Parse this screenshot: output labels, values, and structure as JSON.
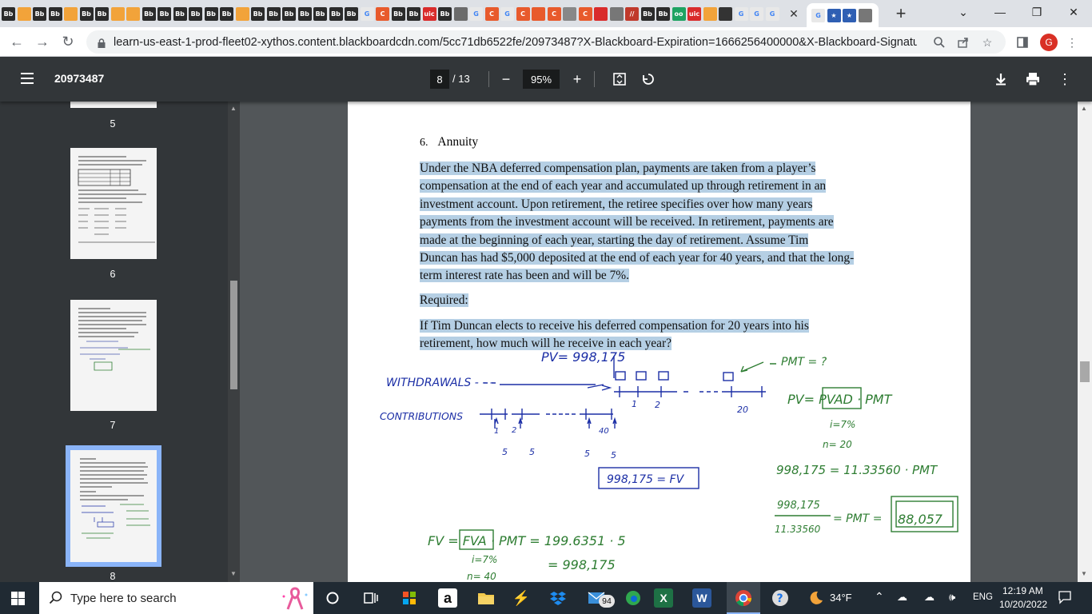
{
  "browser": {
    "tab_favicons": [
      {
        "label": "Bb",
        "color": "#2b2b2b"
      },
      {
        "label": "",
        "color": "#f2a33a"
      },
      {
        "label": "Bb",
        "color": "#2b2b2b"
      },
      {
        "label": "Bb",
        "color": "#2b2b2b"
      },
      {
        "label": "",
        "color": "#f2a33a"
      },
      {
        "label": "Bb",
        "color": "#2b2b2b"
      },
      {
        "label": "Bb",
        "color": "#2b2b2b"
      },
      {
        "label": "",
        "color": "#f2a33a"
      },
      {
        "label": "",
        "color": "#f2a33a"
      },
      {
        "label": "Bb",
        "color": "#2b2b2b"
      },
      {
        "label": "Bb",
        "color": "#2b2b2b"
      },
      {
        "label": "Bb",
        "color": "#2b2b2b"
      },
      {
        "label": "Bb",
        "color": "#2b2b2b"
      },
      {
        "label": "Bb",
        "color": "#2b2b2b"
      },
      {
        "label": "Bb",
        "color": "#2b2b2b"
      },
      {
        "label": "",
        "color": "#f2a33a"
      },
      {
        "label": "Bb",
        "color": "#2b2b2b"
      },
      {
        "label": "Bb",
        "color": "#2b2b2b"
      },
      {
        "label": "Bb",
        "color": "#2b2b2b"
      },
      {
        "label": "Bb",
        "color": "#2b2b2b"
      },
      {
        "label": "Bb",
        "color": "#2b2b2b"
      },
      {
        "label": "Bb",
        "color": "#2b2b2b"
      },
      {
        "label": "Bb",
        "color": "#2b2b2b"
      },
      {
        "label": "G",
        "color": "#e8e8e8"
      },
      {
        "label": "C",
        "color": "#e85a2c"
      },
      {
        "label": "Bb",
        "color": "#2b2b2b"
      },
      {
        "label": "Bb",
        "color": "#2b2b2b"
      },
      {
        "label": "uic",
        "color": "#d92b2b"
      },
      {
        "label": "Bb",
        "color": "#2b2b2b"
      },
      {
        "label": "",
        "color": "#6b6b6b"
      },
      {
        "label": "G",
        "color": "#e8e8e8"
      },
      {
        "label": "C",
        "color": "#e85a2c"
      },
      {
        "label": "G",
        "color": "#e8e8e8"
      },
      {
        "label": "C",
        "color": "#e85a2c"
      },
      {
        "label": "",
        "color": "#e85a2c"
      },
      {
        "label": "C",
        "color": "#e85a2c"
      },
      {
        "label": "",
        "color": "#888888"
      },
      {
        "label": "C",
        "color": "#e85a2c"
      },
      {
        "label": "",
        "color": "#d92b2b"
      },
      {
        "label": "",
        "color": "#777777"
      },
      {
        "label": "//",
        "color": "#c0392b"
      },
      {
        "label": "Bb",
        "color": "#2b2b2b"
      },
      {
        "label": "Bb",
        "color": "#2b2b2b"
      },
      {
        "label": "oo",
        "color": "#1ea362"
      },
      {
        "label": "uic",
        "color": "#d92b2b"
      },
      {
        "label": "",
        "color": "#f2a33a"
      },
      {
        "label": "",
        "color": "#333333"
      },
      {
        "label": "G",
        "color": "#e8e8e8"
      },
      {
        "label": "G",
        "color": "#e8e8e8"
      },
      {
        "label": "G",
        "color": "#e8e8e8"
      }
    ],
    "after_favicons": [
      {
        "label": "G",
        "color": "#e8e8e8"
      },
      {
        "label": "★",
        "color": "#2f5fb3"
      },
      {
        "label": "★",
        "color": "#2f5fb3"
      },
      {
        "label": "",
        "color": "#777777"
      }
    ],
    "url": "learn-us-east-1-prod-fleet02-xythos.content.blackboardcdn.com/5cc71db6522fe/20973487?X-Blackboard-Expiration=1666256400000&X-Blackboard-Signature=S...",
    "profile_initial": "G"
  },
  "pdf": {
    "title": "20973487",
    "current_page": "8",
    "total_pages": "/ 13",
    "zoom": "95%"
  },
  "thumbnails": [
    {
      "num": "5"
    },
    {
      "num": "6"
    },
    {
      "num": "7"
    },
    {
      "num": "8"
    }
  ],
  "document": {
    "heading_number": "6.",
    "heading_text": "Annuity",
    "para_lines": [
      "Under the NBA deferred compensation plan, payments are taken from a player’s",
      "compensation at the end of each year and accumulated up through retirement in an",
      "investment account.  Upon retirement, the retiree specifies over how many years",
      "payments from the investment account will be received.  In retirement, payments are",
      "made at the beginning of each year, starting the day of retirement.  Assume Tim",
      "Duncan has had $5,000 deposited at the end of each year for 40 years, and that the long-",
      "term interest rate has been and will be 7%."
    ],
    "required": "Required:",
    "question_lines": [
      "If Tim Duncan elects to receive his deferred compensation for 20 years into his",
      "retirement, how much will he receive in each year?"
    ],
    "handwriting": {
      "pv_top": "PV= 998,175",
      "pmt_q": "PMT = ?",
      "withdrawals": "WITHDRAWALS - - -",
      "contributions": "CONTRIBUTIONS",
      "tick_1": "1",
      "tick_2": "2",
      "tick_20": "20",
      "under_1": "1",
      "under_2": "2",
      "under_40": "40",
      "five_a": "5",
      "five_b": "5",
      "five_c": "5",
      "five_d": "5",
      "fv_box": "998,175 = FV",
      "pv_formula": "PV= PVAD · PMT",
      "rate_r": "i=7%",
      "n_r": "n= 20",
      "eq_line": "998,175 = 11.33560 · PMT",
      "frac_num": "998,175",
      "frac_den": "11.33560",
      "pmt_eq": "= PMT =",
      "answer": "88,057",
      "fv_formula": "FV = FVA · PMT = 199.6351 · 5",
      "rate_l": "i=7%",
      "fv_result": "= 998,175",
      "n_l": "n= 40"
    }
  },
  "taskbar": {
    "search_placeholder": "Type here to search",
    "mail_badge": "94",
    "temperature": "34°F",
    "language": "ENG",
    "time": "12:19 AM",
    "date": "10/20/2022"
  },
  "colors": {
    "highlight": "#b5cfe4",
    "ink_blue": "#1c2fa6",
    "ink_green": "#2e7d32",
    "pdf_toolbar": "#323639"
  }
}
